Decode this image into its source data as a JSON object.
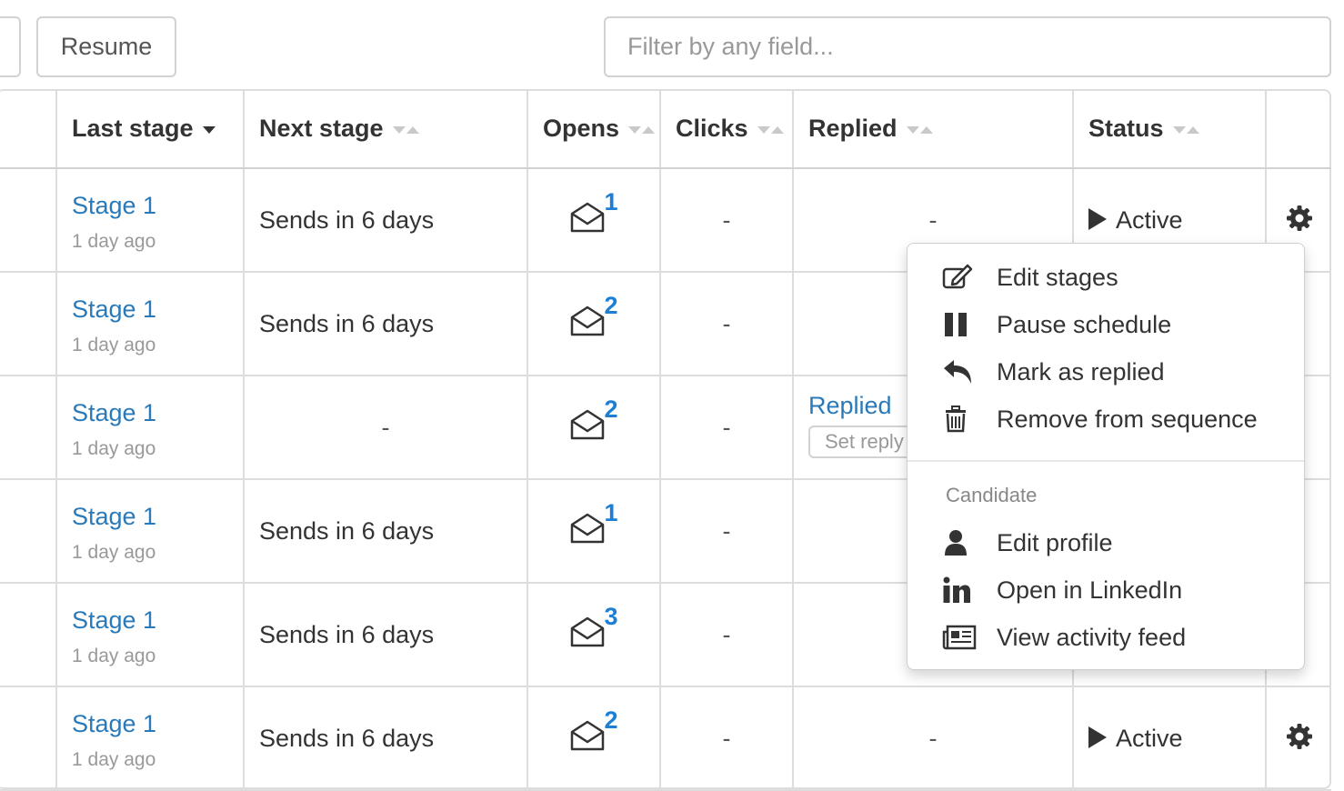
{
  "toolbar": {
    "resume_label": "Resume",
    "filter_placeholder": "Filter by any field..."
  },
  "table": {
    "headers": {
      "last_stage": "Last stage",
      "next_stage": "Next stage",
      "opens": "Opens",
      "clicks": "Clicks",
      "replied": "Replied",
      "status": "Status"
    },
    "rows": [
      {
        "stage": "Stage 1",
        "time": "1 day ago",
        "next": "Sends in 6 days",
        "opens": "1",
        "clicks": "-",
        "replied": "-",
        "status": "Active"
      },
      {
        "stage": "Stage 1",
        "time": "1 day ago",
        "next": "Sends in 6 days",
        "opens": "2",
        "clicks": "-"
      },
      {
        "stage": "Stage 1",
        "time": "1 day ago",
        "next": "-",
        "opens": "2",
        "clicks": "-",
        "replied": "Replied",
        "set_reply": "Set reply"
      },
      {
        "stage": "Stage 1",
        "time": "1 day ago",
        "next": "Sends in 6 days",
        "opens": "1",
        "clicks": "-"
      },
      {
        "stage": "Stage 1",
        "time": "1 day ago",
        "next": "Sends in 6 days",
        "opens": "3",
        "clicks": "-"
      },
      {
        "stage": "Stage 1",
        "time": "1 day ago",
        "next": "Sends in 6 days",
        "opens": "2",
        "clicks": "-",
        "replied": "-",
        "status": "Active"
      }
    ]
  },
  "menu": {
    "edit_stages": "Edit stages",
    "pause_schedule": "Pause schedule",
    "mark_replied": "Mark as replied",
    "remove": "Remove from sequence",
    "section_header": "Candidate",
    "edit_profile": "Edit profile",
    "open_linkedin": "Open in LinkedIn",
    "view_activity": "View activity feed"
  },
  "colors": {
    "link": "#2a7ab9",
    "opens_count": "#1d7fd4",
    "border": "#dddddd"
  }
}
